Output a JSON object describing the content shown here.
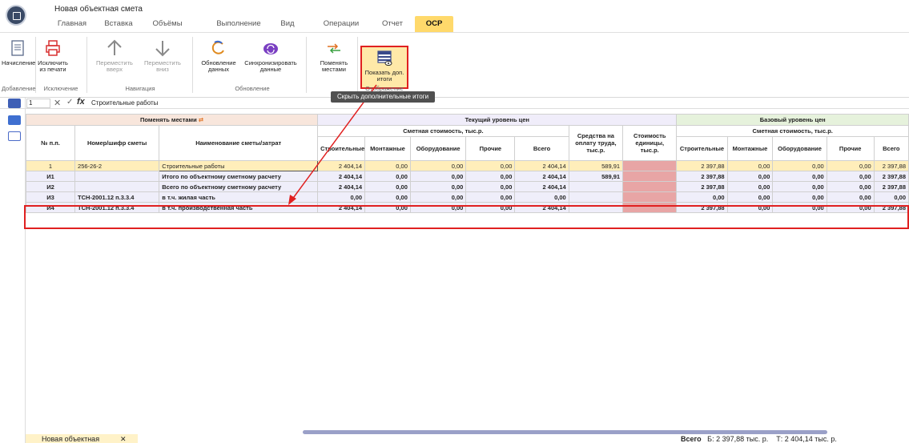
{
  "app": {
    "title": "Новая объектная смета"
  },
  "menu": {
    "tabs": [
      "Главная",
      "Вставка",
      "Объёмы",
      "Выполнение",
      "Вид",
      "Операции",
      "Отчет",
      "ОСР"
    ],
    "active": "ОСР"
  },
  "ribbon": {
    "buttons": {
      "accrual": "Начисление",
      "exclude_print": "Исключить из печати",
      "move_up": "Переместить вверх",
      "move_down": "Переместить вниз",
      "update_data": "Обновление данных",
      "sync_data": "Синхронизировать данные",
      "swap": "Поменять местами",
      "show_totals": "Показать доп. итоги"
    },
    "groups": {
      "adding": "Добавление",
      "exclusion": "Исключение",
      "navigation": "Навигация",
      "update": "Обновление",
      "display": "Отображение"
    },
    "tooltip": "Скрыть дополнительные итоги"
  },
  "formula_bar": {
    "cell": "1",
    "value": "Строительные работы"
  },
  "table": {
    "header": {
      "swap_label": "Поменять местами",
      "current_level": "Текущий уровень цен",
      "base_level": "Базовый уровень цен",
      "estimated_cost": "Сметная стоимость, тыс.р.",
      "num": "№ п.п.",
      "code": "Номер/шифр сметы",
      "name": "Наименование сметы/затрат",
      "construction": "Строительные",
      "installation": "Монтажные",
      "equipment": "Оборудование",
      "other": "Прочие",
      "total": "Всего",
      "wage_fund": "Средства на оплату труда, тыс.р.",
      "unit_cost": "Стоимость единицы, тыс.р."
    },
    "rows": [
      {
        "num": "1",
        "code": "256-26-2",
        "name": "Строительные работы",
        "c1": "2 404,14",
        "c2": "0,00",
        "c3": "0,00",
        "c4": "0,00",
        "c5": "2 404,14",
        "c6": "589,91",
        "b1": "2 397,88",
        "b2": "0,00",
        "b3": "0,00",
        "b4": "0,00",
        "b5": "2 397,88"
      },
      {
        "num": "И1",
        "code": "",
        "name": "Итого по объектному сметному расчету",
        "c1": "2 404,14",
        "c2": "0,00",
        "c3": "0,00",
        "c4": "0,00",
        "c5": "2 404,14",
        "c6": "589,91",
        "b1": "2 397,88",
        "b2": "0,00",
        "b3": "0,00",
        "b4": "0,00",
        "b5": "2 397,88"
      },
      {
        "num": "И2",
        "code": "",
        "name": "Всего по объектному сметному расчету",
        "c1": "2 404,14",
        "c2": "0,00",
        "c3": "0,00",
        "c4": "0,00",
        "c5": "2 404,14",
        "c6": "",
        "b1": "2 397,88",
        "b2": "0,00",
        "b3": "0,00",
        "b4": "0,00",
        "b5": "2 397,88"
      },
      {
        "num": "И3",
        "code": "ТСН-2001.12 п.3.3.4",
        "name": "в т.ч. жилая часть",
        "c1": "0,00",
        "c2": "0,00",
        "c3": "0,00",
        "c4": "0,00",
        "c5": "0,00",
        "c6": "",
        "b1": "0,00",
        "b2": "0,00",
        "b3": "0,00",
        "b4": "0,00",
        "b5": "0,00"
      },
      {
        "num": "И4",
        "code": "ТСН-2001.12 п.3.3.4",
        "name": "в т.ч. производственная часть",
        "c1": "2 404,14",
        "c2": "0,00",
        "c3": "0,00",
        "c4": "0,00",
        "c5": "2 404,14",
        "c6": "",
        "b1": "2 397,88",
        "b2": "0,00",
        "b3": "0,00",
        "b4": "0,00",
        "b5": "2 397,88"
      }
    ]
  },
  "bottom": {
    "doc_tab": "Новая объектная",
    "status_label": "Всего",
    "status_b": "Б: 2 397,88 тыс. р.",
    "status_t": "Т: 2 404,14 тыс. р."
  },
  "colors": {
    "active_tab": "#ffd96b",
    "highlight_red": "#e02020",
    "row_selected": "#ffeeba",
    "unit_cost_cell": "#e8a5a5"
  }
}
